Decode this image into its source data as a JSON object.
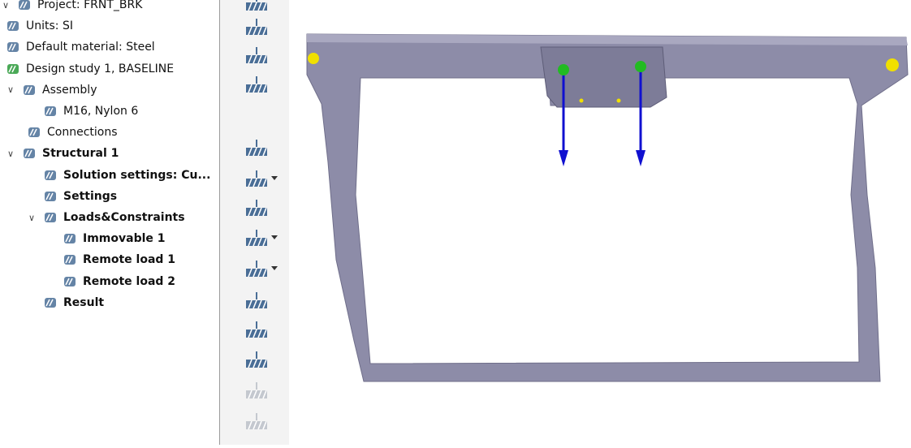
{
  "tree": {
    "items": [
      {
        "label": "Project: FRNT_BRK",
        "icon": "project-icon",
        "bold": false
      },
      {
        "label": "Units: SI",
        "icon": "ruler-icon",
        "bold": false
      },
      {
        "label": "Default material: Steel",
        "icon": "material-icon",
        "bold": false
      },
      {
        "label": "Design study 1, BASELINE",
        "icon": "design-study-check-icon",
        "bold": false
      },
      {
        "label": "Assembly",
        "icon": "assembly-icon",
        "bold": false,
        "expanded": true
      },
      {
        "label": "M16, Nylon 6",
        "icon": "bolt-icon",
        "bold": false
      },
      {
        "label": "Connections",
        "icon": "connections-icon",
        "bold": false
      },
      {
        "label": "Structural  1",
        "icon": "structural-icon",
        "bold": true,
        "expanded": true
      },
      {
        "label": "Solution settings: Cu...",
        "icon": "gear-icon",
        "bold": true
      },
      {
        "label": "Settings",
        "icon": "settings-wave-icon",
        "bold": true
      },
      {
        "label": "Loads&Constraints",
        "icon": "loads-constraints-icon",
        "bold": true,
        "expanded": true
      },
      {
        "label": "Immovable 1",
        "icon": "immovable-icon",
        "bold": true
      },
      {
        "label": "Remote load 1",
        "icon": "remote-load-icon",
        "bold": true
      },
      {
        "label": "Remote load 2",
        "icon": "remote-load-icon",
        "bold": true
      },
      {
        "label": "Result",
        "icon": "result-icon",
        "bold": true
      }
    ]
  },
  "toolbar": {
    "tools": [
      "fixed-constraint-icon",
      "bearing-constraint-icon",
      "pin-constraint-icon",
      "sliding-constraint-icon",
      "force-load-icon",
      "remote-load-icon",
      "gravity-load-icon",
      "moment-load-icon",
      "remote-force-icon",
      "thermal-load-icon",
      "rotational-load-icon",
      "contact-icon",
      "disabled-funnel-icon",
      "disabled-cyclic-icon"
    ]
  },
  "colors": {
    "model": "#8d8ca8",
    "icon": "#4a6e96",
    "arrow": "#1010d0",
    "marker_green": "#22bb22",
    "marker_yellow": "#f0e000"
  }
}
